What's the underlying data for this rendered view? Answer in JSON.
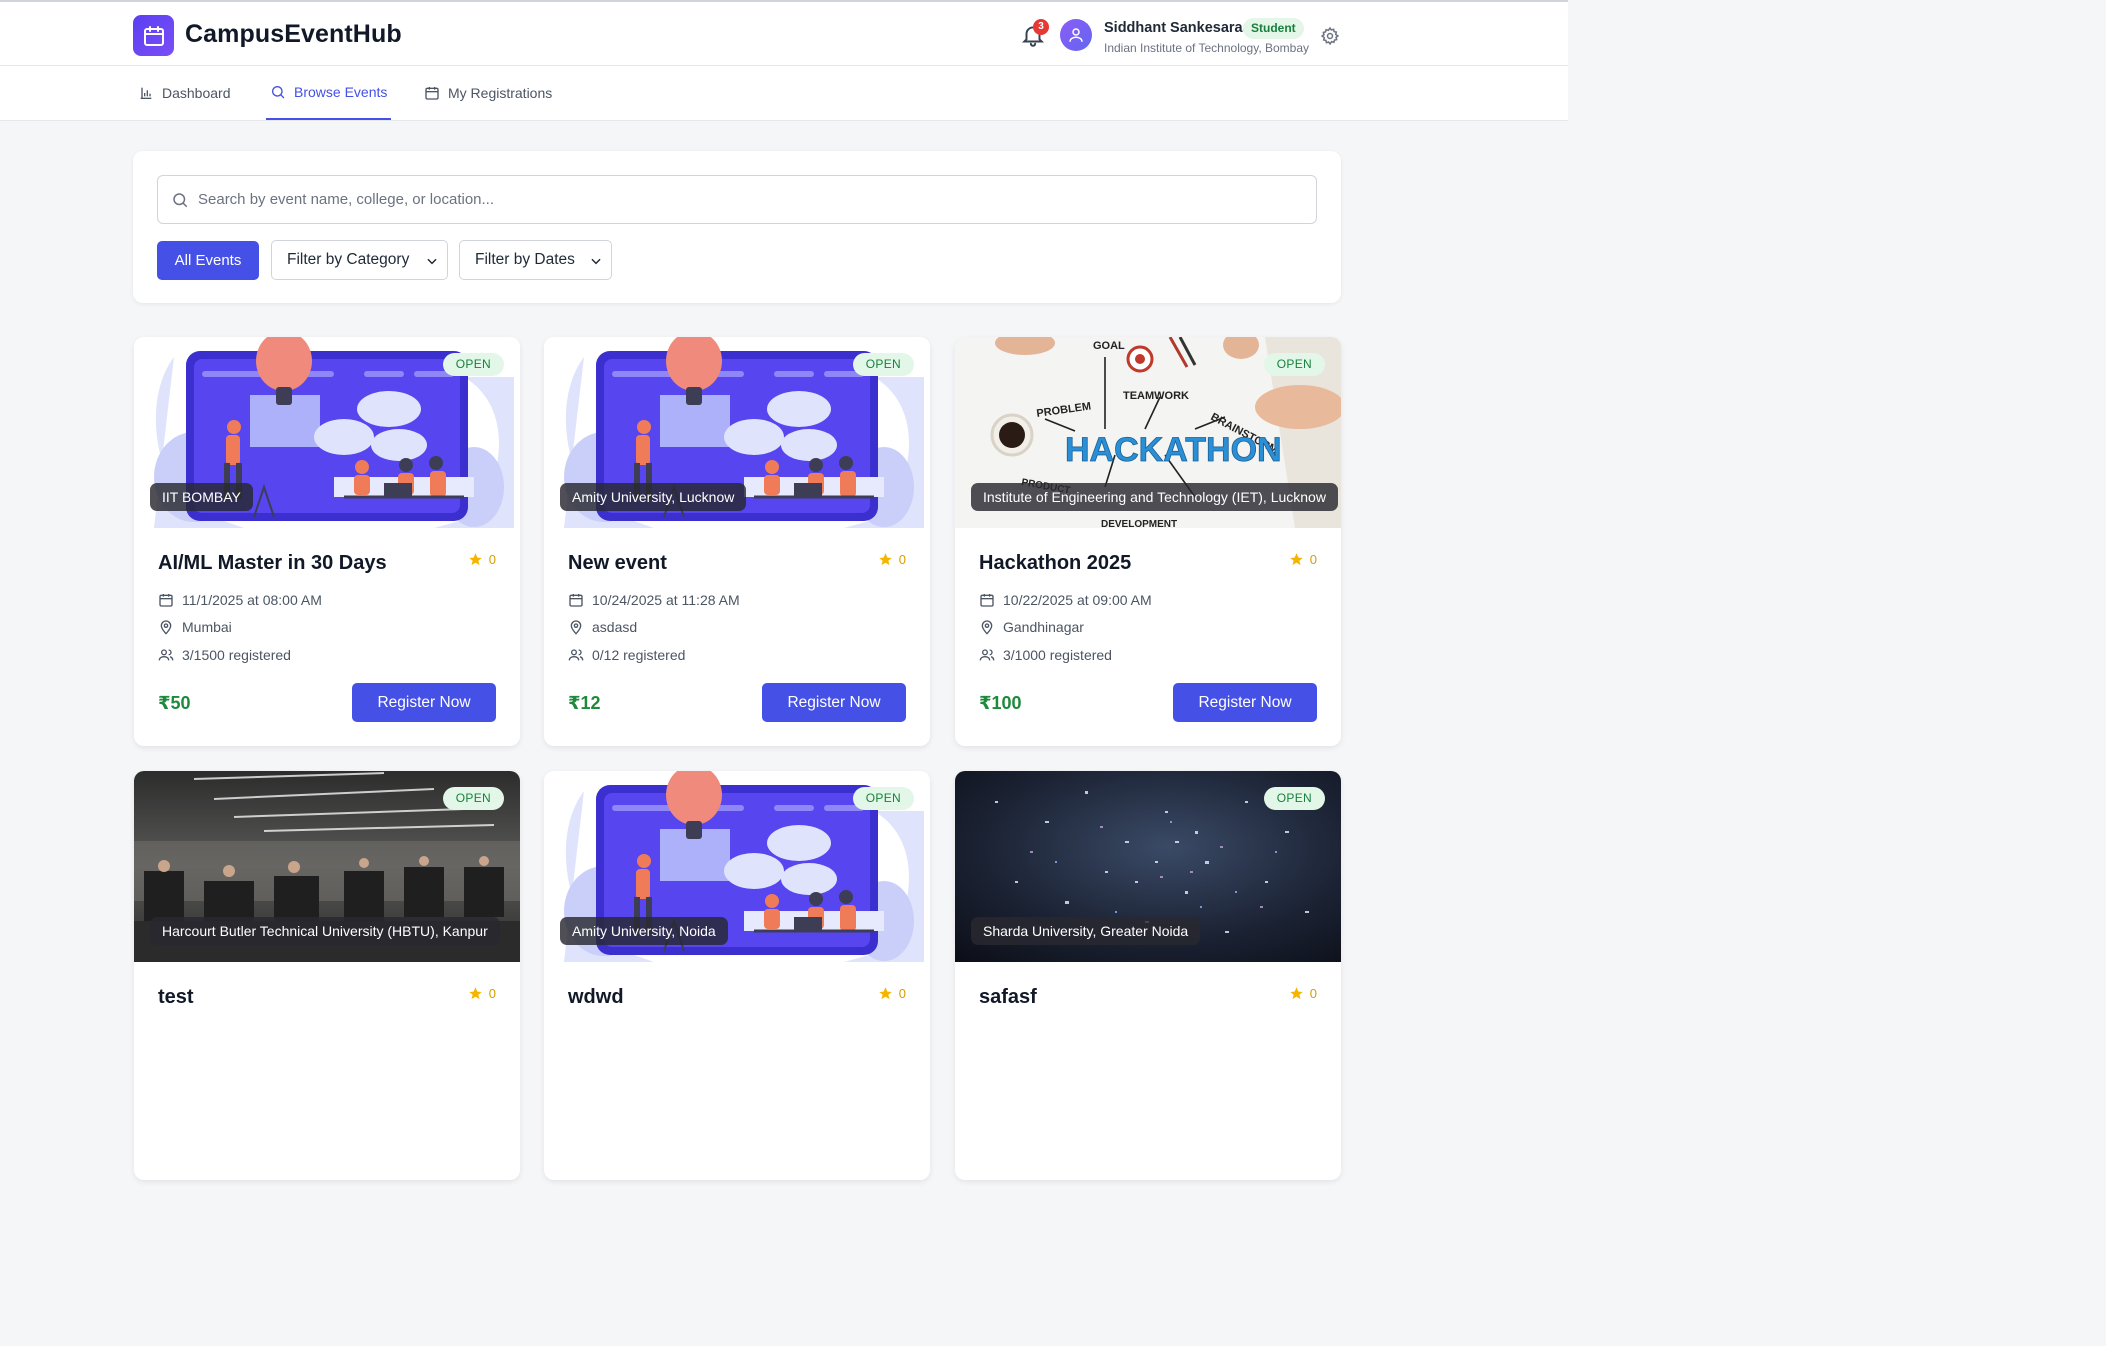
{
  "app": {
    "title": "CampusEventHub",
    "notification_count": "3"
  },
  "user": {
    "name": "Siddhant Sankesaraa",
    "role": "Student",
    "org": "Indian Institute of Technology, Bombay"
  },
  "nav": {
    "tabs": [
      {
        "label": "Dashboard",
        "icon": "bar-chart-icon"
      },
      {
        "label": "Browse Events",
        "icon": "search-icon",
        "active": true
      },
      {
        "label": "My Registrations",
        "icon": "calendar-icon"
      }
    ]
  },
  "search": {
    "placeholder": "Search by event name, college, or location..."
  },
  "filters": {
    "all": "All Events",
    "category": "Filter by Category",
    "dates": "Filter by Dates"
  },
  "colors": {
    "primary": "#4450e6",
    "price": "#1e8a3c",
    "open_badge_bg": "#e3f7e9",
    "star": "#f4b400"
  },
  "events": [
    {
      "title": "AI/ML Master in 30 Days",
      "status": "OPEN",
      "college": "IIT BOMBAY",
      "rating": "0",
      "datetime": "11/1/2025 at 08:00 AM",
      "location": "Mumbai",
      "registered": "3/1500 registered",
      "price": "₹50",
      "cta": "Register Now",
      "image": "illustration"
    },
    {
      "title": "New event",
      "status": "OPEN",
      "college": "Amity University, Lucknow",
      "rating": "0",
      "datetime": "10/24/2025 at 11:28 AM",
      "location": "asdasd",
      "registered": "0/12 registered",
      "price": "₹12",
      "cta": "Register Now",
      "image": "illustration"
    },
    {
      "title": "Hackathon 2025",
      "status": "OPEN",
      "college": "Institute of Engineering and Technology (IET), Lucknow",
      "rating": "0",
      "datetime": "10/22/2025 at 09:00 AM",
      "location": "Gandhinagar",
      "registered": "3/1000 registered",
      "price": "₹100",
      "cta": "Register Now",
      "image": "hackathon",
      "image_text": {
        "goal": "GOAL",
        "teamwork": "TEAMWORK",
        "problem": "PROBLEM",
        "brainstorm": "BRAINSTORM",
        "main": "HACKATHON",
        "product": "PRODUCT",
        "development": "DEVELOPMENT"
      }
    },
    {
      "title": "test",
      "status": "OPEN",
      "college": "Harcourt Butler Technical University (HBTU), Kanpur",
      "rating": "0",
      "image": "office"
    },
    {
      "title": "wdwd",
      "status": "OPEN",
      "college": "Amity University, Noida",
      "rating": "0",
      "image": "illustration"
    },
    {
      "title": "safasf",
      "status": "OPEN",
      "college": "Sharda University, Greater Noida",
      "rating": "0",
      "image": "confetti"
    }
  ]
}
